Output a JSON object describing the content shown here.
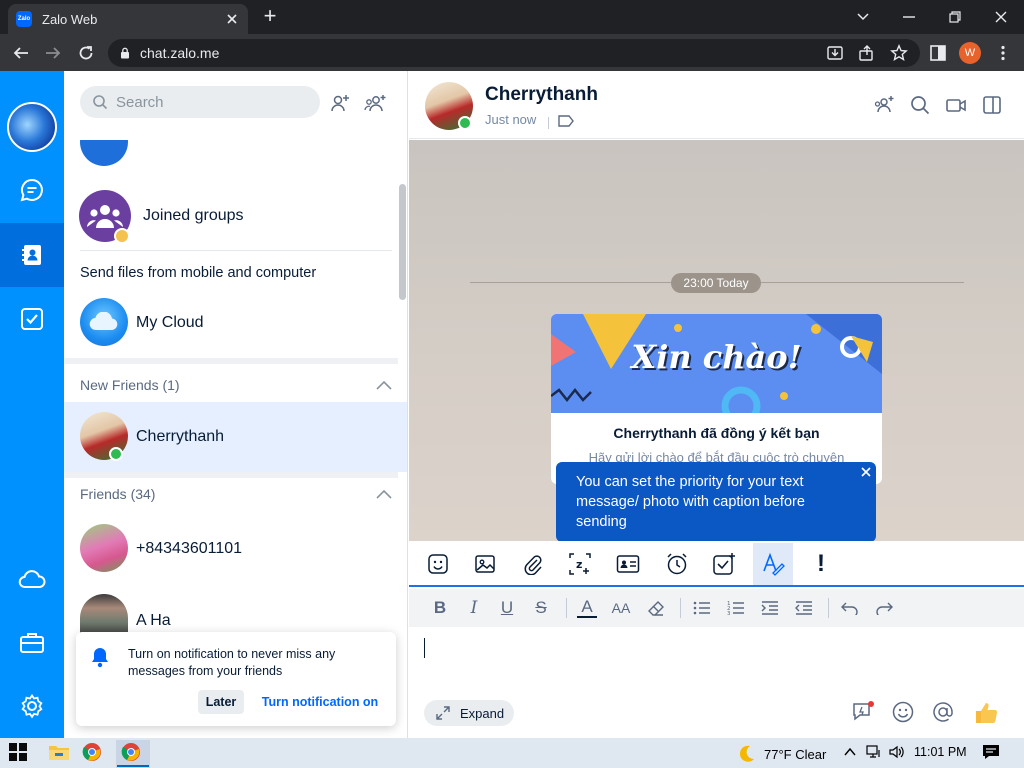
{
  "browser": {
    "tab_title": "Zalo Web",
    "tab_icon_text": "Zalo",
    "url": "chat.zalo.me",
    "profile_initial": "W"
  },
  "contacts": {
    "search_placeholder": "Search",
    "joined_groups": "Joined groups",
    "send_files_label": "Send files from mobile and computer",
    "my_cloud": "My Cloud",
    "new_friends_header": "New Friends (1)",
    "new_friend_name": "Cherrythanh",
    "friends_header": "Friends (34)",
    "friends": [
      {
        "name": "+84343601101"
      },
      {
        "name": "A Ha"
      }
    ]
  },
  "notification": {
    "message": "Turn on notification to never miss any messages from your friends",
    "later_label": "Later",
    "turn_on_label": "Turn notification on"
  },
  "chat": {
    "name": "Cherrythanh",
    "status": "Just now",
    "time_divider": "23:00 Today",
    "card_banner_text": "Xin chào!",
    "card_title": "Cherrythanh đã đồng ý kết bạn",
    "card_subtitle": "Hãy gửi lời chào để bắt đầu cuộc trò chuyện",
    "tooltip": "You can set the priority for your text message/ photo with caption before sending",
    "expand_label": "Expand"
  },
  "taskbar": {
    "weather": "77°F  Clear",
    "time": "11:01 PM"
  },
  "colors": {
    "nav_blue": "#0091ff",
    "nav_active": "#006edc",
    "brand_blue": "#0068ff",
    "tooltip_bg": "#0b57c4"
  }
}
